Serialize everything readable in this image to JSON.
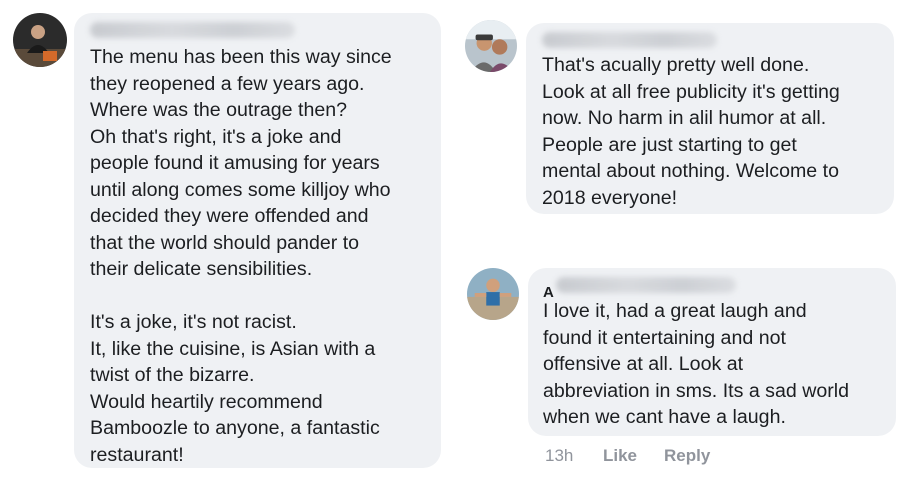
{
  "comments": [
    {
      "author_initial": "",
      "avatar_icon": "user-photo-dark",
      "text": "The menu has been this way since\nthey reopened a few years ago.\nWhere was the outrage then?\nOh that's right, it's a joke and\npeople found it amusing for years\nuntil along comes some killjoy who\ndecided they were offended and\nthat the world should pander to\ntheir delicate sensibilities.\n\nIt's a joke, it's not racist.\nIt, like the cuisine, is Asian with a\ntwist of the bizarre.\nWould heartily recommend\nBamboozle to anyone, a fantastic\nrestaurant!"
    },
    {
      "author_initial": "",
      "avatar_icon": "user-photo-couple",
      "text": "That's acually pretty well done.\nLook at all free publicity it's getting\nnow. No harm in alil humor at all.\nPeople are just starting to get\nmental about nothing. Welcome to\n2018 everyone!"
    },
    {
      "author_initial": "A",
      "avatar_icon": "user-photo-outdoor",
      "text": "I love it, had a great laugh and\nfound it entertaining and not\noffensive at all. Look at\nabbreviation in sms. Its a sad world\nwhen we cant have a laugh.",
      "time": "13h",
      "like_label": "Like",
      "reply_label": "Reply"
    }
  ]
}
